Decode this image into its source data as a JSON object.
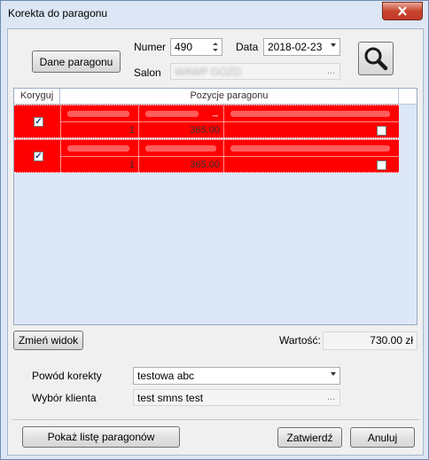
{
  "window": {
    "title": "Korekta do paragonu"
  },
  "header": {
    "receipt_button": "Dane paragonu",
    "number_label": "Numer",
    "number_value": "490",
    "date_label": "Data",
    "date_value": "2018-02-23",
    "store_label": "Salon",
    "store_value": "WAWP GOZD",
    "store_ellipsis": "..."
  },
  "grid": {
    "columns": [
      "Koryguj",
      "Pozycje paragonu"
    ],
    "rows": [
      {
        "koryguj_checked": true,
        "line_checked": false,
        "qty": "1",
        "price": "365.00",
        "cursor": "_"
      },
      {
        "koryguj_checked": true,
        "line_checked": false,
        "qty": "1",
        "price": "365.00",
        "cursor": ""
      }
    ]
  },
  "summary": {
    "change_view_button": "Zmień widok",
    "value_label": "Wartość:",
    "value": "730.00 zł"
  },
  "form": {
    "reason_label": "Powód korekty",
    "reason_value": "testowa abc",
    "client_label": "Wybór klienta",
    "client_value": "test smns test",
    "client_ellipsis": "..."
  },
  "footer": {
    "show_list_button": "Pokaż listę paragonów",
    "confirm_button": "Zatwierdź",
    "cancel_button": "Anuluj"
  },
  "colors": {
    "row_highlight": "#ff0000",
    "grid_bg": "#dce8f7",
    "window_frame": "#dce6f4"
  }
}
